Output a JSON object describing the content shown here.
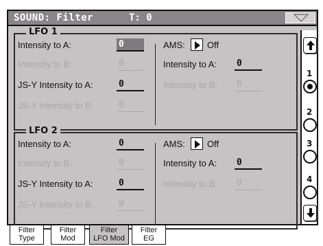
{
  "header": {
    "title": "SOUND: Filter",
    "tempo": "T: 0"
  },
  "lfo1": {
    "title": "LFO 1",
    "left": {
      "intensity_a": {
        "label": "Intensity to A:",
        "value": "0"
      },
      "intensity_b": {
        "label": "Intensity to B:",
        "value": "0"
      },
      "jsy_a": {
        "label": "JS-Y Intensity to A:",
        "value": "0"
      },
      "jsy_b": {
        "label": "JS-Y Intensity to B:",
        "value": "0"
      }
    },
    "right": {
      "ams_label": "AMS:",
      "ams_value": "Off",
      "intensity_a": {
        "label": "Intensity to A:",
        "value": "0"
      },
      "intensity_b": {
        "label": "Intensity to B:",
        "value": "0"
      }
    }
  },
  "lfo2": {
    "title": "LFO 2",
    "left": {
      "intensity_a": {
        "label": "Intensity to A:",
        "value": "0"
      },
      "intensity_b": {
        "label": "Intensity to B:",
        "value": "0"
      },
      "jsy_a": {
        "label": "JS-Y Intensity to A:",
        "value": "0"
      },
      "jsy_b": {
        "label": "JS-Y Intensity to B:",
        "value": "0"
      }
    },
    "right": {
      "ams_label": "AMS:",
      "ams_value": "Off",
      "intensity_a": {
        "label": "Intensity to A:",
        "value": "0"
      },
      "intensity_b": {
        "label": "Intensity to B:",
        "value": "0"
      }
    }
  },
  "pages": [
    "1",
    "2",
    "3",
    "4"
  ],
  "selected_page": "1",
  "tabs": [
    {
      "line1": "Filter",
      "line2": "Type"
    },
    {
      "line1": "Filter",
      "line2": "Mod"
    },
    {
      "line1": "Filter",
      "line2": "LFO Mod"
    },
    {
      "line1": "Filter",
      "line2": "EG"
    }
  ],
  "active_tab": 2,
  "icons": {
    "menu": "triangle-down-icon",
    "ams": "play-triangle-icon",
    "scroll_up": "arrow-up-icon",
    "scroll_down": "arrow-down-icon"
  },
  "colors": {
    "panel": "#c7c2c4",
    "titlebar": "#8a8588",
    "dim_text": "#a9a5a7"
  }
}
